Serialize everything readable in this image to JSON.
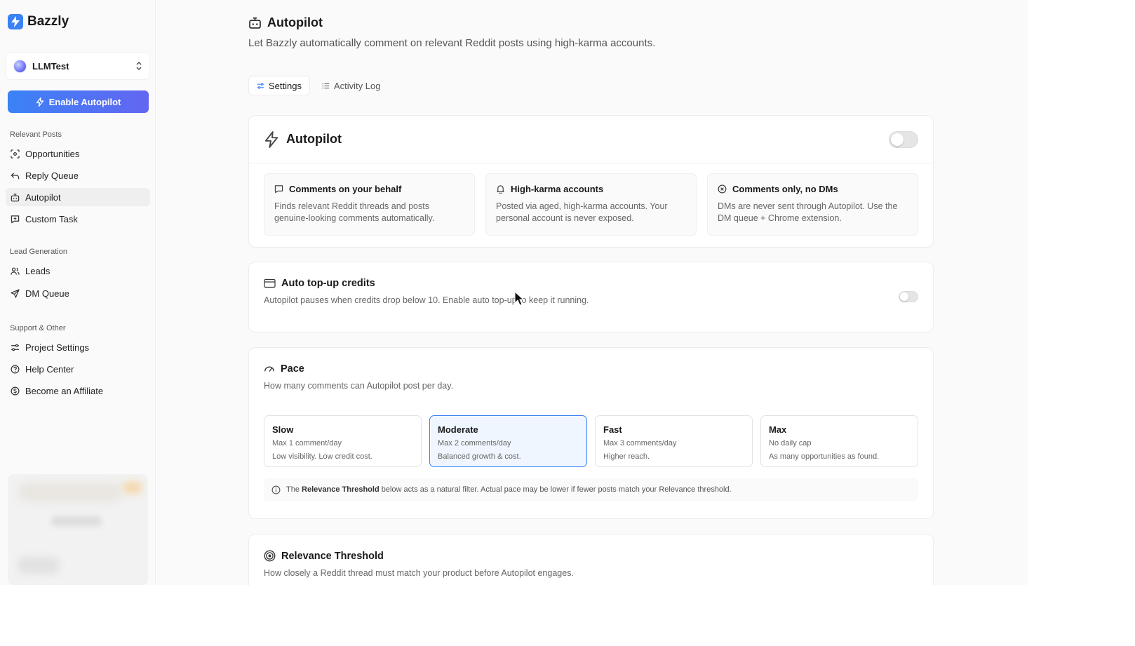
{
  "brand": {
    "name": "Bazzly"
  },
  "project": {
    "name": "LLMTest"
  },
  "sidebar": {
    "enable_button": "Enable Autopilot",
    "sections": [
      {
        "label": "Relevant Posts",
        "items": [
          "Opportunities",
          "Reply Queue",
          "Autopilot",
          "Custom Task"
        ]
      },
      {
        "label": "Lead Generation",
        "items": [
          "Leads",
          "DM Queue"
        ]
      },
      {
        "label": "Support & Other",
        "items": [
          "Project Settings",
          "Help Center",
          "Become an Affiliate"
        ]
      }
    ],
    "active_item": "Autopilot"
  },
  "header": {
    "title": "Autopilot",
    "subtitle": "Let Bazzly automatically comment on relevant Reddit posts using high-karma accounts."
  },
  "tabs": [
    {
      "label": "Settings",
      "active": true,
      "icon": "sliders-icon"
    },
    {
      "label": "Activity Log",
      "active": false,
      "icon": "list-icon"
    }
  ],
  "autopilot_card": {
    "title": "Autopilot",
    "enabled": false,
    "features": [
      {
        "title": "Comments on your behalf",
        "desc": "Finds relevant Reddit threads and posts genuine-looking comments automatically.",
        "icon": "message-square-icon"
      },
      {
        "title": "High-karma accounts",
        "desc": "Posted via aged, high-karma accounts. Your personal account is never exposed.",
        "icon": "bell-icon"
      },
      {
        "title": "Comments only, no DMs",
        "desc": "DMs are never sent through Autopilot. Use the DM queue + Chrome extension.",
        "icon": "x-circle-icon"
      }
    ]
  },
  "topup_card": {
    "title": "Auto top-up credits",
    "desc": "Autopilot pauses when credits drop below 10. Enable auto top-up to keep it running.",
    "enabled": false
  },
  "pace_card": {
    "title": "Pace",
    "desc": "How many comments can Autopilot post per day.",
    "options": [
      {
        "name": "Slow",
        "line1": "Max 1 comment/day",
        "line2": "Low visibility. Low credit cost.",
        "selected": false
      },
      {
        "name": "Moderate",
        "line1": "Max 2 comments/day",
        "line2": "Balanced growth & cost.",
        "selected": true
      },
      {
        "name": "Fast",
        "line1": "Max 3 comments/day",
        "line2": "Higher reach.",
        "selected": false
      },
      {
        "name": "Max",
        "line1": "No daily cap",
        "line2": "As many opportunities as found.",
        "selected": false
      }
    ],
    "note_prefix": "The",
    "note_bold": "Relevance Threshold",
    "note_suffix": "below acts as a natural filter. Actual pace may be lower if fewer posts match your Relevance threshold."
  },
  "relevance_card": {
    "title": "Relevance Threshold",
    "desc": "How closely a Reddit thread must match your product before Autopilot engages."
  },
  "colors": {
    "accent": "#3b82f6",
    "accent_end": "#6366f1",
    "selected_bg": "#eff6ff"
  }
}
